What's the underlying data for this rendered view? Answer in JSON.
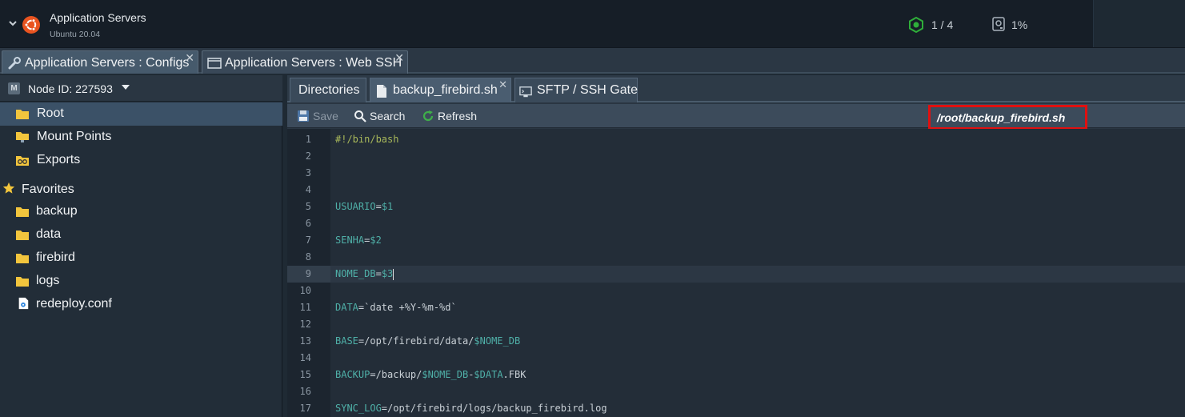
{
  "header": {
    "app_title": "Application Servers",
    "app_subtitle": "Ubuntu 20.04",
    "nodes_count": "1 / 4",
    "disk_usage": "1%"
  },
  "main_tabs": [
    {
      "label": "Application Servers : Configs",
      "icon": "wrench-icon",
      "close": "✕"
    },
    {
      "label": "Application Servers : Web SSH",
      "icon": "terminal-window-icon",
      "close": "✕"
    }
  ],
  "node_selector": {
    "label": "Node ID: 227593"
  },
  "tree": {
    "root": "Root",
    "mount_points": "Mount Points",
    "exports": "Exports",
    "favorites": "Favorites",
    "favorite_items": [
      "backup",
      "data",
      "firebird",
      "logs",
      "redeploy.conf"
    ]
  },
  "sub_tabs": [
    {
      "label": "Directories"
    },
    {
      "label": "backup_firebird.sh",
      "close": "✕"
    },
    {
      "label": "SFTP / SSH Gate"
    }
  ],
  "toolbar": {
    "save": "Save",
    "search": "Search",
    "refresh": "Refresh",
    "file_path": "/root/backup_firebird.sh"
  },
  "editor": {
    "current_line": 9,
    "lines": [
      {
        "n": "1",
        "parts": [
          {
            "t": "#!/bin/bash",
            "c": "shebang"
          }
        ]
      },
      {
        "n": "2",
        "parts": []
      },
      {
        "n": "3",
        "parts": []
      },
      {
        "n": "4",
        "parts": []
      },
      {
        "n": "5",
        "parts": [
          {
            "t": "USUARIO",
            "c": "var"
          },
          {
            "t": "=",
            "c": "op"
          },
          {
            "t": "$1",
            "c": "var"
          }
        ]
      },
      {
        "n": "6",
        "parts": []
      },
      {
        "n": "7",
        "parts": [
          {
            "t": "SENHA",
            "c": "var"
          },
          {
            "t": "=",
            "c": "op"
          },
          {
            "t": "$2",
            "c": "var"
          }
        ]
      },
      {
        "n": "8",
        "parts": []
      },
      {
        "n": "9",
        "parts": [
          {
            "t": "NOME_DB",
            "c": "var"
          },
          {
            "t": "=",
            "c": "op"
          },
          {
            "t": "$3",
            "c": "var"
          }
        ]
      },
      {
        "n": "10",
        "parts": []
      },
      {
        "n": "11",
        "parts": [
          {
            "t": "DATA",
            "c": "var"
          },
          {
            "t": "=`date +%Y-%m-%d`",
            "c": "plain"
          }
        ]
      },
      {
        "n": "12",
        "parts": []
      },
      {
        "n": "13",
        "parts": [
          {
            "t": "BASE",
            "c": "var"
          },
          {
            "t": "=/opt/firebird/data/",
            "c": "plain"
          },
          {
            "t": "$NOME_DB",
            "c": "var"
          }
        ]
      },
      {
        "n": "14",
        "parts": []
      },
      {
        "n": "15",
        "parts": [
          {
            "t": "BACKUP",
            "c": "var"
          },
          {
            "t": "=/backup/",
            "c": "plain"
          },
          {
            "t": "$NOME_DB",
            "c": "var"
          },
          {
            "t": "-",
            "c": "plain"
          },
          {
            "t": "$DATA",
            "c": "var"
          },
          {
            "t": ".FBK",
            "c": "plain"
          }
        ]
      },
      {
        "n": "16",
        "parts": []
      },
      {
        "n": "17",
        "parts": [
          {
            "t": "SYNC_LOG",
            "c": "var"
          },
          {
            "t": "=/opt/firebird/logs/backup_firebird.log",
            "c": "plain"
          }
        ]
      }
    ]
  },
  "colors": {
    "accent_selected": "#3b5167",
    "path_highlight": "#e01010",
    "ubuntu_orange": "#e95420",
    "folder_yellow": "#f2c53d",
    "var_teal": "#4fb0a8",
    "shebang_olive": "#a8b85a"
  }
}
